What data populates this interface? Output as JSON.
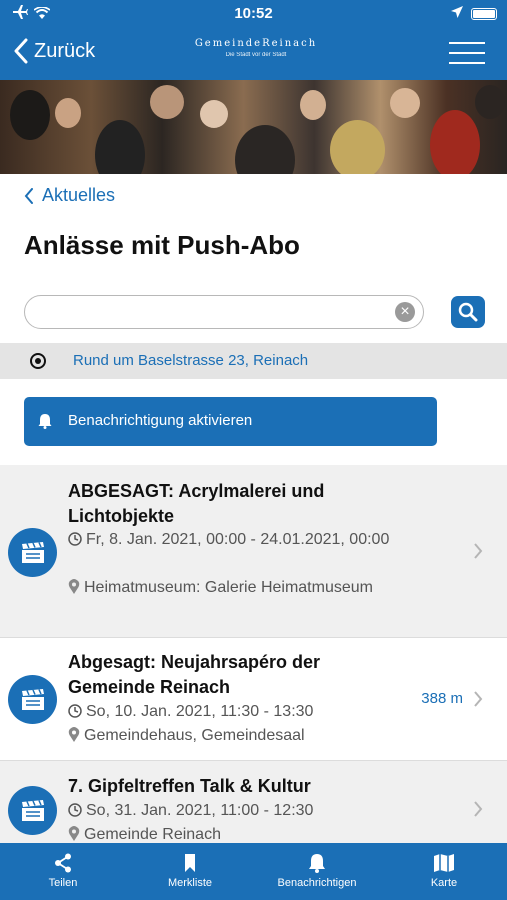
{
  "status_bar": {
    "time": "10:52"
  },
  "nav": {
    "back_label": "Zurück",
    "logo_line1": "GemeindeReinach",
    "logo_line2": "Die Stadt vor der Stadt"
  },
  "breadcrumb": {
    "label": "Aktuelles"
  },
  "page": {
    "title": "Anlässe mit Push-Abo"
  },
  "search": {
    "value": "",
    "placeholder": ""
  },
  "location": {
    "address": "Rund um Baselstrasse 23, Reinach"
  },
  "notify": {
    "label": "Benachrichtigung aktivieren"
  },
  "events": [
    {
      "title": "ABGESAGT: Acrylmalerei und Lichtobjekte",
      "date": "Fr, 8. Jan. 2021, 00:00 - 24.01.2021, 00:00",
      "place": "Heimatmuseum: Galerie Heimatmuseum",
      "distance": ""
    },
    {
      "title": "Abgesagt: Neujahrsapéro der Gemeinde Reinach",
      "date": "So, 10. Jan. 2021, 11:30 - 13:30",
      "place": "Gemeindehaus, Gemeindesaal",
      "distance": "388 m"
    },
    {
      "title": "7. Gipfeltreffen Talk & Kultur",
      "date": "So, 31. Jan. 2021, 11:00 - 12:30",
      "place": "Gemeinde Reinach",
      "distance": ""
    }
  ],
  "tabs": [
    {
      "label": "Teilen",
      "icon": "share-icon"
    },
    {
      "label": "Merkliste",
      "icon": "bookmark-icon"
    },
    {
      "label": "Benachrichtigen",
      "icon": "bell-icon"
    },
    {
      "label": "Karte",
      "icon": "map-icon"
    }
  ],
  "colors": {
    "brand": "#1b6fb6",
    "row_alt": "#f0f0f0",
    "location_bar": "#e4e4e4"
  }
}
